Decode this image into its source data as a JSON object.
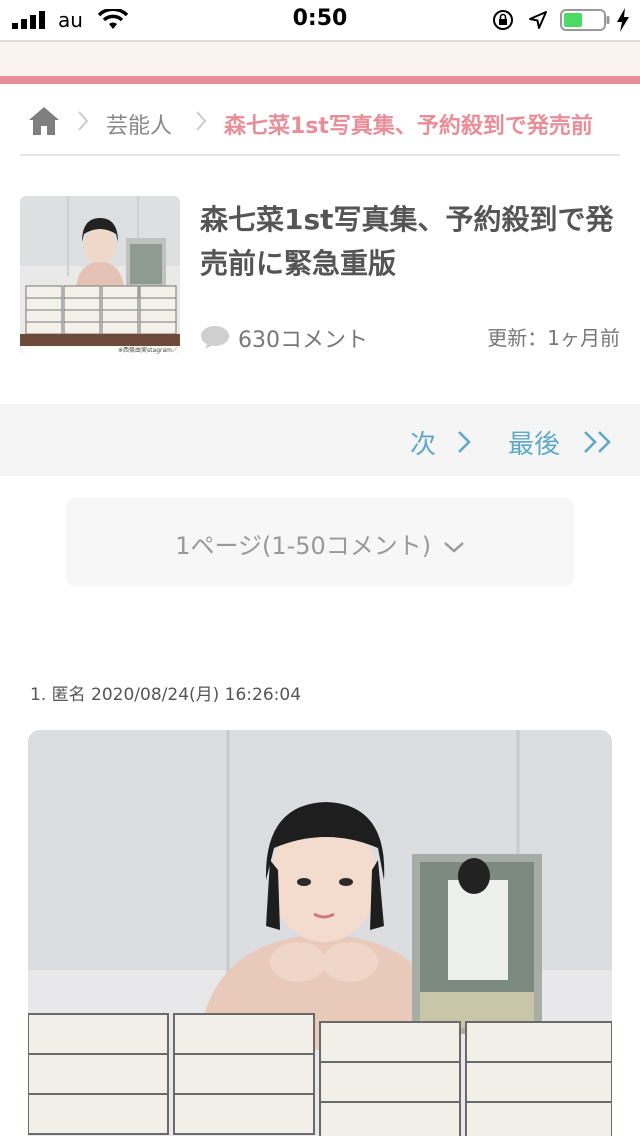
{
  "status_bar": {
    "carrier": "au",
    "time": "0:50"
  },
  "breadcrumb": {
    "category": "芸能人",
    "current": "森七菜1st写真集、予約殺到で発売前"
  },
  "article": {
    "title": "森七菜1st写真集、予約殺到で発売前に緊急重版",
    "comment_count": "630コメント",
    "updated": "更新：1ヶ月前",
    "thumb_caption": "※西條由実stagram／"
  },
  "pager": {
    "next_label": "次",
    "last_label": "最後"
  },
  "page_select": {
    "label": "1ページ(1-50コメント)"
  },
  "comments": [
    {
      "meta": "1. 匿名 2020/08/24(月) 16:26:04"
    }
  ],
  "colors": {
    "accent_pink": "#e88e98",
    "link_blue": "#5fa8c8"
  }
}
